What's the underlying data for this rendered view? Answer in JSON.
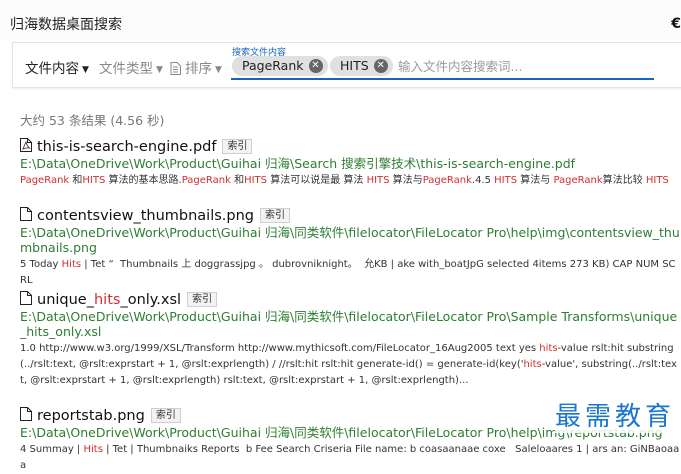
{
  "app": {
    "title": "归海数据桌面搜索",
    "corner_glyph": "€"
  },
  "search": {
    "filters": [
      {
        "label": "文件内容",
        "active": true
      },
      {
        "label": "文件类型",
        "active": false
      },
      {
        "label": "排序",
        "active": false
      }
    ],
    "field_label": "搜索文件内容",
    "chips": [
      {
        "label": "PageRank"
      },
      {
        "label": "HITS"
      }
    ],
    "placeholder": "输入文件内容搜索词...",
    "value": ""
  },
  "summary": "大约 53 条结果 (4.56 秒)",
  "index_badge": "索引",
  "results": [
    {
      "icon": "pdf-file-icon",
      "title": "this-is-search-engine.pdf",
      "path": "E:\\Data\\OneDrive\\Work\\Product\\Guihai 归海\\Search 搜索引擎技术\\this-is-search-engine.pdf",
      "snippet": [
        {
          "t": "PageRank",
          "h": true
        },
        {
          "t": " 和",
          "h": false
        },
        {
          "t": "HITS",
          "h": true
        },
        {
          "t": " 算法的基本思路.",
          "h": false
        },
        {
          "t": "PageRank",
          "h": true
        },
        {
          "t": " 和",
          "h": false
        },
        {
          "t": "HITS",
          "h": true
        },
        {
          "t": " 算法可以说是最 算法 ",
          "h": false
        },
        {
          "t": "HITS",
          "h": true
        },
        {
          "t": " 算法与",
          "h": false
        },
        {
          "t": "PageRank",
          "h": true
        },
        {
          "t": ".4.5 ",
          "h": false
        },
        {
          "t": "HITS",
          "h": true
        },
        {
          "t": " 算法与 ",
          "h": false
        },
        {
          "t": "PageRank",
          "h": true
        },
        {
          "t": "算法比较 ",
          "h": false
        },
        {
          "t": "HITS",
          "h": true
        }
      ]
    },
    {
      "icon": "file-icon",
      "title": "contentsview_thumbnails.png",
      "path": "E:\\Data\\OneDrive\\Work\\Product\\Guihai 归海\\同类软件\\filelocator\\FileLocator Pro\\help\\img\\contentsview_thumbnails.png",
      "snippet": [
        {
          "t": "5 Today ",
          "h": false
        },
        {
          "t": "Hits",
          "h": true
        },
        {
          "t": " | Tet “  Thumbnails 上 doggrassjpg 。 dubrovniknight。  允KB | ake with_boatJpG selected 4items 273 KB) CAP NUM SCRL",
          "h": false
        }
      ]
    },
    {
      "icon": "file-icon",
      "title": "unique_hits_only.xsl",
      "title_parts": [
        {
          "t": "unique_",
          "h": false
        },
        {
          "t": "hits",
          "h": true
        },
        {
          "t": "_only.xsl",
          "h": false
        }
      ],
      "path": "E:\\Data\\OneDrive\\Work\\Product\\Guihai 归海\\同类软件\\filelocator\\FileLocator Pro\\Sample Transforms\\unique_hits_only.xsl",
      "snippet": [
        {
          "t": "1.0 http://www.w3.org/1999/XSL/Transform http://www.mythicsoft.com/FileLocator_16Aug2005 text yes ",
          "h": false
        },
        {
          "t": "hits",
          "h": true
        },
        {
          "t": "-value rslt:hit substring(../rslt:text, @rslt:exprstart + 1, @rslt:exprlength) / //rslt:hit rslt:hit generate-id() = generate-id(key('",
          "h": false
        },
        {
          "t": "hits",
          "h": true
        },
        {
          "t": "-value', substring(../rslt:text, @rslt:exprstart + 1, @rslt:exprlength) rslt:text, @rslt:exprstart + 1, @rslt:exprlength)...",
          "h": false
        }
      ]
    },
    {
      "icon": "file-icon",
      "title": "reportstab.png",
      "path": "E:\\Data\\OneDrive\\Work\\Product\\Guihai 归海\\同类软件\\filelocator\\FileLocator Pro\\help\\img\\reportstab.png",
      "snippet": [
        {
          "t": "4 Summay | ",
          "h": false
        },
        {
          "t": "Hits",
          "h": true
        },
        {
          "t": " | Tet | Thumbnaiks Reports  b Fee Search Criseria File name: b coasaanaae coxe   Saleloaares 1 | ars an: GiNBaoaaa",
          "h": false
        }
      ]
    }
  ],
  "watermark": "最需教育",
  "colors": {
    "accent": "#1565c0",
    "path_green": "#2e7d32",
    "highlight_red": "#d32f2f",
    "watermark_blue": "#1976d2"
  }
}
